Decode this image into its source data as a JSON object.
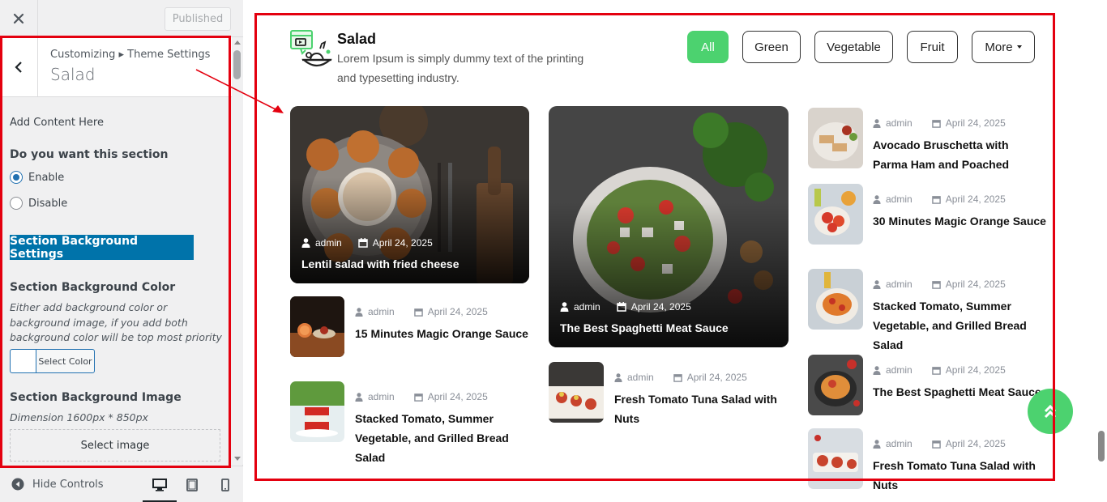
{
  "sidebar": {
    "published_label": "Published",
    "breadcrumb": "Customizing ▸ Theme Settings",
    "panel_title": "Salad",
    "add_content": "Add Content Here",
    "section_toggle_heading": "Do you want this section",
    "enable_label": "Enable",
    "disable_label": "Disable",
    "enable_checked": true,
    "section_bg_settings_label": "Section Background Settings",
    "bg_color_heading": "Section Background Color",
    "bg_color_desc": "Either add background color or background image, if you add both background color will be top most priority",
    "select_color_label": "Select Color",
    "bg_image_heading": "Section Background Image",
    "dimension_text": "Dimension 1600px * 850px",
    "select_image_label": "Select image",
    "hide_controls_label": "Hide Controls"
  },
  "section": {
    "title": "Salad",
    "description": "Lorem Ipsum is simply dummy text of the printing and typesetting industry.",
    "filters": [
      "All",
      "Green",
      "Vegetable",
      "Fruit",
      "More"
    ],
    "active_filter": "All"
  },
  "featured": [
    {
      "author": "admin",
      "date": "April 24, 2025",
      "title": "Lentil salad with fried cheese"
    },
    {
      "author": "admin",
      "date": "April 24, 2025",
      "title": "The Best Spaghetti Meat Sauce"
    }
  ],
  "col1_posts": [
    {
      "author": "admin",
      "date": "April 24, 2025",
      "title": "15 Minutes Magic Orange Sauce"
    },
    {
      "author": "admin",
      "date": "April 24, 2025",
      "title": "Stacked Tomato, Summer Vegetable, and Grilled Bread Salad"
    }
  ],
  "col2_posts": [
    {
      "author": "admin",
      "date": "April 24, 2025",
      "title": "Fresh Tomato Tuna Salad with Nuts"
    }
  ],
  "col3_posts": [
    {
      "author": "admin",
      "date": "April 24, 2025",
      "title": "Avocado Bruschetta with Parma Ham and Poached"
    },
    {
      "author": "admin",
      "date": "April 24, 2025",
      "title": "30 Minutes Magic Orange Sauce"
    },
    {
      "author": "admin",
      "date": "April 24, 2025",
      "title": "Stacked Tomato, Summer Vegetable, and Grilled Bread Salad"
    },
    {
      "author": "admin",
      "date": "April 24, 2025",
      "title": "The Best Spaghetti Meat Sauce"
    },
    {
      "author": "admin",
      "date": "April 24, 2025",
      "title": "Fresh Tomato Tuna Salad with Nuts"
    }
  ],
  "colors": {
    "accent_green": "#4cd26f",
    "wp_blue": "#0073aa",
    "highlight_red": "#e4000f"
  },
  "icons": [
    "close-icon",
    "back-chevron-icon",
    "salad-bowl-icon",
    "user-icon",
    "calendar-icon",
    "double-chevron-up-icon",
    "hide-controls-icon",
    "desktop-icon",
    "tablet-icon",
    "mobile-icon"
  ]
}
